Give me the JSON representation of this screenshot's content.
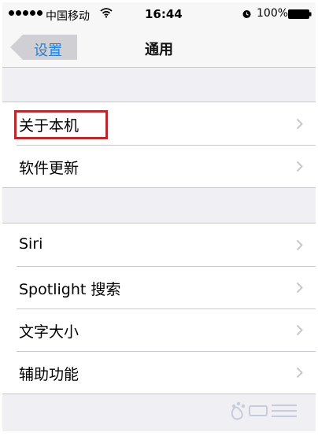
{
  "status_bar": {
    "carrier": "中国移动",
    "time": "16:44",
    "battery_percent": "100%"
  },
  "nav": {
    "back_label": "设置",
    "title": "通用"
  },
  "groups": [
    {
      "items": [
        {
          "label": "关于本机",
          "highlighted": true
        },
        {
          "label": "软件更新"
        }
      ]
    },
    {
      "items": [
        {
          "label": "Siri"
        },
        {
          "label": "Spotlight 搜索"
        },
        {
          "label": "文字大小"
        },
        {
          "label": "辅助功能"
        }
      ]
    }
  ],
  "icons": {
    "back": "chevron-left-icon",
    "disclosure": "chevron-right-icon",
    "wifi": "wifi-icon",
    "alarm": "alarm-icon",
    "battery": "battery-icon",
    "watermark": "baidu-watermark-icon"
  },
  "colors": {
    "accent": "#2f7fd1",
    "highlight_border": "#b52a2f",
    "separator": "#c8c7cc",
    "background": "#efeff4"
  }
}
